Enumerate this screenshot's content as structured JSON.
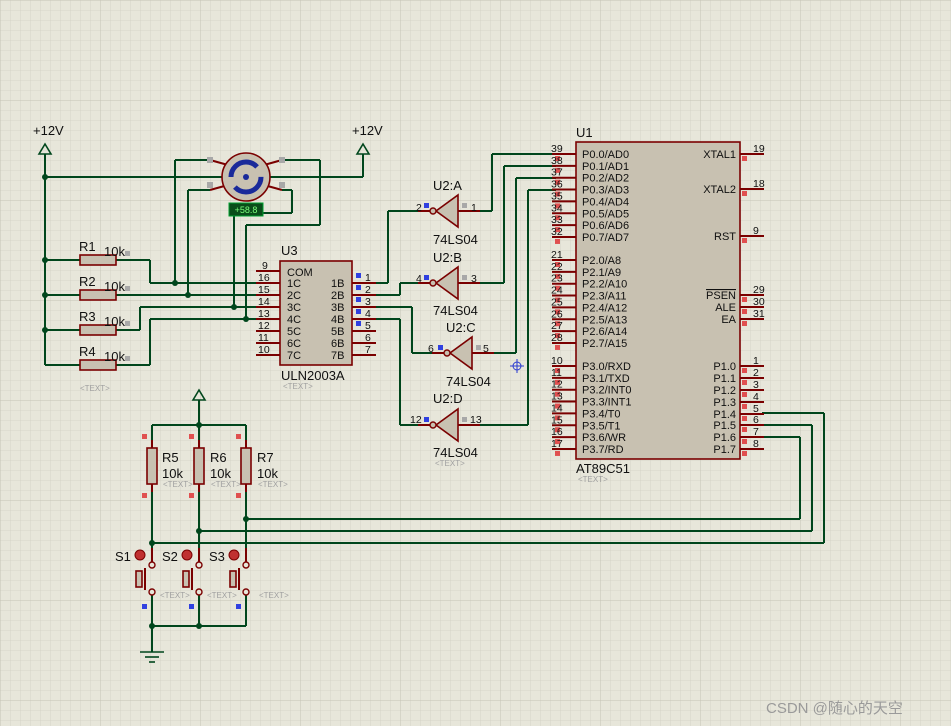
{
  "power": {
    "left_label": "+12V",
    "right_label": "+12V"
  },
  "motor": {
    "speed_readout": "+58.8"
  },
  "resistors_left": [
    {
      "ref": "R1",
      "value": "10k"
    },
    {
      "ref": "R2",
      "value": "10k"
    },
    {
      "ref": "R3",
      "value": "10k"
    },
    {
      "ref": "R4",
      "value": "10k"
    }
  ],
  "resistors_pullup": [
    {
      "ref": "R5",
      "value": "10k"
    },
    {
      "ref": "R6",
      "value": "10k"
    },
    {
      "ref": "R7",
      "value": "10k"
    }
  ],
  "switches": [
    {
      "ref": "S1"
    },
    {
      "ref": "S2"
    },
    {
      "ref": "S3"
    }
  ],
  "text_placeholder": "<TEXT>",
  "uln": {
    "ref": "U3",
    "part": "ULN2003A",
    "com_label": "COM",
    "left_pins": [
      {
        "num": "9",
        "name": ""
      },
      {
        "num": "16",
        "name": "1C"
      },
      {
        "num": "15",
        "name": "2C"
      },
      {
        "num": "14",
        "name": "3C"
      },
      {
        "num": "13",
        "name": "4C"
      },
      {
        "num": "12",
        "name": "5C"
      },
      {
        "num": "11",
        "name": "6C"
      },
      {
        "num": "10",
        "name": "7C"
      }
    ],
    "right_pins": [
      {
        "num": "1",
        "name": "1B"
      },
      {
        "num": "2",
        "name": "2B"
      },
      {
        "num": "3",
        "name": "3B"
      },
      {
        "num": "4",
        "name": "4B"
      },
      {
        "num": "5",
        "name": "5B"
      },
      {
        "num": "6",
        "name": "6B"
      },
      {
        "num": "7",
        "name": "7B"
      }
    ]
  },
  "inverters": [
    {
      "ref": "U2:A",
      "part": "74LS04",
      "in_pin": "1",
      "out_pin": "2"
    },
    {
      "ref": "U2:B",
      "part": "74LS04",
      "in_pin": "3",
      "out_pin": "4"
    },
    {
      "ref": "U2:C",
      "part": "74LS04",
      "in_pin": "5",
      "out_pin": "6"
    },
    {
      "ref": "U2:D",
      "part": "74LS04",
      "in_pin": "13",
      "out_pin": "12"
    }
  ],
  "mcu": {
    "ref": "U1",
    "part": "AT89C51",
    "left_pins": [
      {
        "num": "39",
        "name": "P0.0/AD0"
      },
      {
        "num": "38",
        "name": "P0.1/AD1"
      },
      {
        "num": "37",
        "name": "P0.2/AD2"
      },
      {
        "num": "36",
        "name": "P0.3/AD3"
      },
      {
        "num": "35",
        "name": "P0.4/AD4"
      },
      {
        "num": "34",
        "name": "P0.5/AD5"
      },
      {
        "num": "33",
        "name": "P0.6/AD6"
      },
      {
        "num": "32",
        "name": "P0.7/AD7"
      },
      {
        "num": "21",
        "name": "P2.0/A8"
      },
      {
        "num": "22",
        "name": "P2.1/A9"
      },
      {
        "num": "23",
        "name": "P2.2/A10"
      },
      {
        "num": "24",
        "name": "P2.3/A11"
      },
      {
        "num": "25",
        "name": "P2.4/A12"
      },
      {
        "num": "26",
        "name": "P2.5/A13"
      },
      {
        "num": "27",
        "name": "P2.6/A14"
      },
      {
        "num": "28",
        "name": "P2.7/A15"
      },
      {
        "num": "10",
        "name": "P3.0/RXD"
      },
      {
        "num": "11",
        "name": "P3.1/TXD"
      },
      {
        "num": "12",
        "name": "P3.2/INT0"
      },
      {
        "num": "13",
        "name": "P3.3/INT1"
      },
      {
        "num": "14",
        "name": "P3.4/T0"
      },
      {
        "num": "15",
        "name": "P3.5/T1"
      },
      {
        "num": "16",
        "name": "P3.6/WR"
      },
      {
        "num": "17",
        "name": "P3.7/RD"
      }
    ],
    "right_pins": [
      {
        "num": "19",
        "name": "XTAL1"
      },
      {
        "num": "18",
        "name": "XTAL2"
      },
      {
        "num": "9",
        "name": "RST"
      },
      {
        "num": "29",
        "name": "PSEN"
      },
      {
        "num": "30",
        "name": "ALE"
      },
      {
        "num": "31",
        "name": "EA"
      },
      {
        "num": "1",
        "name": "P1.0"
      },
      {
        "num": "2",
        "name": "P1.1"
      },
      {
        "num": "3",
        "name": "P1.2"
      },
      {
        "num": "4",
        "name": "P1.3"
      },
      {
        "num": "5",
        "name": "P1.4"
      },
      {
        "num": "6",
        "name": "P1.5"
      },
      {
        "num": "7",
        "name": "P1.6"
      },
      {
        "num": "8",
        "name": "P1.7"
      }
    ]
  },
  "watermark": "CSDN @随心的天空"
}
